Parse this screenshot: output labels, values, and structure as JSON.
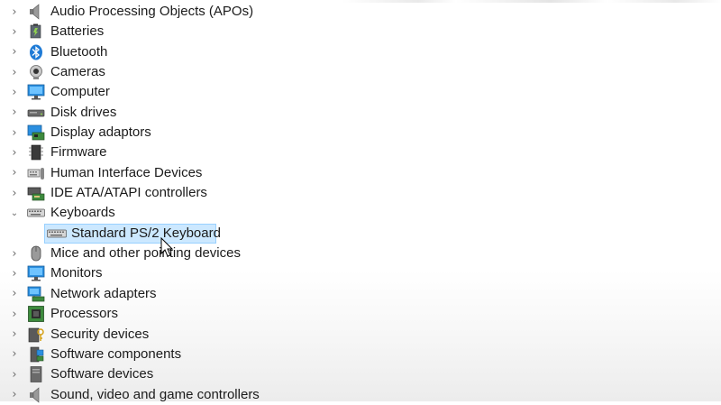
{
  "devices": [
    {
      "label": "Audio Processing Objects (APOs)",
      "icon": "speaker-icon",
      "expanded": false
    },
    {
      "label": "Batteries",
      "icon": "battery-icon",
      "expanded": false
    },
    {
      "label": "Bluetooth",
      "icon": "bluetooth-icon",
      "expanded": false
    },
    {
      "label": "Cameras",
      "icon": "camera-icon",
      "expanded": false
    },
    {
      "label": "Computer",
      "icon": "monitor-icon",
      "expanded": false
    },
    {
      "label": "Disk drives",
      "icon": "disk-drive-icon",
      "expanded": false
    },
    {
      "label": "Display adaptors",
      "icon": "display-adapter-icon",
      "expanded": false
    },
    {
      "label": "Firmware",
      "icon": "chip-icon",
      "expanded": false
    },
    {
      "label": "Human Interface Devices",
      "icon": "hid-icon",
      "expanded": false
    },
    {
      "label": "IDE ATA/ATAPI controllers",
      "icon": "ide-controller-icon",
      "expanded": false
    },
    {
      "label": "Keyboards",
      "icon": "keyboard-icon",
      "expanded": true
    },
    {
      "label": "Standard PS/2 Keyboard",
      "icon": "keyboard-icon",
      "child": true,
      "selected": true
    },
    {
      "label": "Mice and other pointing devices",
      "icon": "mouse-icon",
      "expanded": false
    },
    {
      "label": "Monitors",
      "icon": "monitor-icon",
      "expanded": false
    },
    {
      "label": "Network adapters",
      "icon": "network-icon",
      "expanded": false
    },
    {
      "label": "Processors",
      "icon": "processor-icon",
      "expanded": false
    },
    {
      "label": "Security devices",
      "icon": "security-icon",
      "expanded": false
    },
    {
      "label": "Software components",
      "icon": "software-components-icon",
      "expanded": false
    },
    {
      "label": "Software devices",
      "icon": "software-device-icon",
      "expanded": false
    },
    {
      "label": "Sound, video and game controllers",
      "icon": "speaker-icon",
      "expanded": false
    }
  ],
  "colors": {
    "selection_bg": "#cce8ff",
    "selection_border": "#99d1ff",
    "accent": "#0078d7"
  }
}
